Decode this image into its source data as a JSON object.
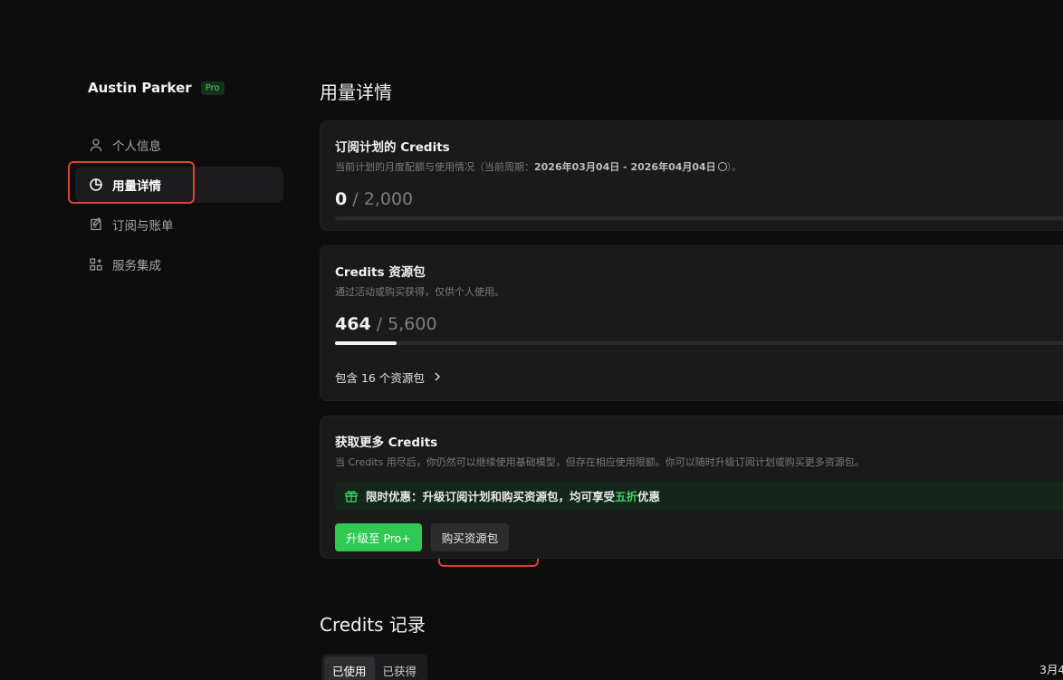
{
  "user": {
    "name": "Austin Parker",
    "badge": "Pro"
  },
  "nav": [
    {
      "label": "个人信息",
      "icon": "user-icon",
      "active": false
    },
    {
      "label": "用量详情",
      "icon": "pie-chart-icon",
      "active": true
    },
    {
      "label": "订阅与账单",
      "icon": "invoice-icon",
      "active": false
    },
    {
      "label": "服务集成",
      "icon": "apps-icon",
      "active": false
    }
  ],
  "page_title": "用量详情",
  "subscription_card": {
    "title": "订阅计划的 Credits",
    "desc_prefix": "当前计划的月度配额与使用情况（当前周期：",
    "period": "2026年03月04日 - 2026年04月04日",
    "desc_suffix": "）。",
    "used": "0",
    "total": "/ 2,000",
    "progress_fraction": 0
  },
  "pack_card": {
    "title": "Credits 资源包",
    "desc": "通过活动或购买获得，仅供个人使用。",
    "used": "464",
    "total": "/ 5,600",
    "progress_fraction": 0.0829,
    "link_label": "包含 16 个资源包"
  },
  "more_card": {
    "title": "获取更多 Credits",
    "desc": "当 Credits 用尽后，你仍然可以继续使用基础模型，但存在相应使用限额。你可以随时升级订阅计划或购买更多资源包。",
    "promo_prefix": "限时优惠：升级订阅计划和购买资源包，均可享受",
    "promo_highlight": "五折",
    "promo_suffix": "优惠",
    "upgrade_label": "升级至 Pro+",
    "buy_label": "购买资源包"
  },
  "records": {
    "title": "Credits 记录",
    "tabs": [
      {
        "label": "已使用",
        "active": true
      },
      {
        "label": "已获得",
        "active": false
      }
    ],
    "date_partial": "3月4"
  },
  "colors": {
    "accent_green": "#30c954",
    "annotation_red": "#e2412c",
    "background": "#0d0d0e"
  }
}
